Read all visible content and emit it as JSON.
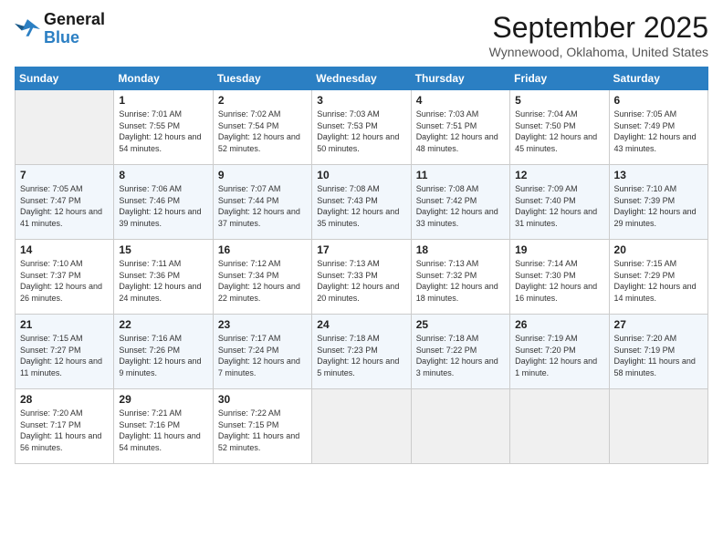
{
  "header": {
    "logo_general": "General",
    "logo_blue": "Blue",
    "month_title": "September 2025",
    "location": "Wynnewood, Oklahoma, United States"
  },
  "days_of_week": [
    "Sunday",
    "Monday",
    "Tuesday",
    "Wednesday",
    "Thursday",
    "Friday",
    "Saturday"
  ],
  "weeks": [
    [
      {
        "day": "",
        "sunrise": "",
        "sunset": "",
        "daylight": ""
      },
      {
        "day": "1",
        "sunrise": "Sunrise: 7:01 AM",
        "sunset": "Sunset: 7:55 PM",
        "daylight": "Daylight: 12 hours and 54 minutes."
      },
      {
        "day": "2",
        "sunrise": "Sunrise: 7:02 AM",
        "sunset": "Sunset: 7:54 PM",
        "daylight": "Daylight: 12 hours and 52 minutes."
      },
      {
        "day": "3",
        "sunrise": "Sunrise: 7:03 AM",
        "sunset": "Sunset: 7:53 PM",
        "daylight": "Daylight: 12 hours and 50 minutes."
      },
      {
        "day": "4",
        "sunrise": "Sunrise: 7:03 AM",
        "sunset": "Sunset: 7:51 PM",
        "daylight": "Daylight: 12 hours and 48 minutes."
      },
      {
        "day": "5",
        "sunrise": "Sunrise: 7:04 AM",
        "sunset": "Sunset: 7:50 PM",
        "daylight": "Daylight: 12 hours and 45 minutes."
      },
      {
        "day": "6",
        "sunrise": "Sunrise: 7:05 AM",
        "sunset": "Sunset: 7:49 PM",
        "daylight": "Daylight: 12 hours and 43 minutes."
      }
    ],
    [
      {
        "day": "7",
        "sunrise": "Sunrise: 7:05 AM",
        "sunset": "Sunset: 7:47 PM",
        "daylight": "Daylight: 12 hours and 41 minutes."
      },
      {
        "day": "8",
        "sunrise": "Sunrise: 7:06 AM",
        "sunset": "Sunset: 7:46 PM",
        "daylight": "Daylight: 12 hours and 39 minutes."
      },
      {
        "day": "9",
        "sunrise": "Sunrise: 7:07 AM",
        "sunset": "Sunset: 7:44 PM",
        "daylight": "Daylight: 12 hours and 37 minutes."
      },
      {
        "day": "10",
        "sunrise": "Sunrise: 7:08 AM",
        "sunset": "Sunset: 7:43 PM",
        "daylight": "Daylight: 12 hours and 35 minutes."
      },
      {
        "day": "11",
        "sunrise": "Sunrise: 7:08 AM",
        "sunset": "Sunset: 7:42 PM",
        "daylight": "Daylight: 12 hours and 33 minutes."
      },
      {
        "day": "12",
        "sunrise": "Sunrise: 7:09 AM",
        "sunset": "Sunset: 7:40 PM",
        "daylight": "Daylight: 12 hours and 31 minutes."
      },
      {
        "day": "13",
        "sunrise": "Sunrise: 7:10 AM",
        "sunset": "Sunset: 7:39 PM",
        "daylight": "Daylight: 12 hours and 29 minutes."
      }
    ],
    [
      {
        "day": "14",
        "sunrise": "Sunrise: 7:10 AM",
        "sunset": "Sunset: 7:37 PM",
        "daylight": "Daylight: 12 hours and 26 minutes."
      },
      {
        "day": "15",
        "sunrise": "Sunrise: 7:11 AM",
        "sunset": "Sunset: 7:36 PM",
        "daylight": "Daylight: 12 hours and 24 minutes."
      },
      {
        "day": "16",
        "sunrise": "Sunrise: 7:12 AM",
        "sunset": "Sunset: 7:34 PM",
        "daylight": "Daylight: 12 hours and 22 minutes."
      },
      {
        "day": "17",
        "sunrise": "Sunrise: 7:13 AM",
        "sunset": "Sunset: 7:33 PM",
        "daylight": "Daylight: 12 hours and 20 minutes."
      },
      {
        "day": "18",
        "sunrise": "Sunrise: 7:13 AM",
        "sunset": "Sunset: 7:32 PM",
        "daylight": "Daylight: 12 hours and 18 minutes."
      },
      {
        "day": "19",
        "sunrise": "Sunrise: 7:14 AM",
        "sunset": "Sunset: 7:30 PM",
        "daylight": "Daylight: 12 hours and 16 minutes."
      },
      {
        "day": "20",
        "sunrise": "Sunrise: 7:15 AM",
        "sunset": "Sunset: 7:29 PM",
        "daylight": "Daylight: 12 hours and 14 minutes."
      }
    ],
    [
      {
        "day": "21",
        "sunrise": "Sunrise: 7:15 AM",
        "sunset": "Sunset: 7:27 PM",
        "daylight": "Daylight: 12 hours and 11 minutes."
      },
      {
        "day": "22",
        "sunrise": "Sunrise: 7:16 AM",
        "sunset": "Sunset: 7:26 PM",
        "daylight": "Daylight: 12 hours and 9 minutes."
      },
      {
        "day": "23",
        "sunrise": "Sunrise: 7:17 AM",
        "sunset": "Sunset: 7:24 PM",
        "daylight": "Daylight: 12 hours and 7 minutes."
      },
      {
        "day": "24",
        "sunrise": "Sunrise: 7:18 AM",
        "sunset": "Sunset: 7:23 PM",
        "daylight": "Daylight: 12 hours and 5 minutes."
      },
      {
        "day": "25",
        "sunrise": "Sunrise: 7:18 AM",
        "sunset": "Sunset: 7:22 PM",
        "daylight": "Daylight: 12 hours and 3 minutes."
      },
      {
        "day": "26",
        "sunrise": "Sunrise: 7:19 AM",
        "sunset": "Sunset: 7:20 PM",
        "daylight": "Daylight: 12 hours and 1 minute."
      },
      {
        "day": "27",
        "sunrise": "Sunrise: 7:20 AM",
        "sunset": "Sunset: 7:19 PM",
        "daylight": "Daylight: 11 hours and 58 minutes."
      }
    ],
    [
      {
        "day": "28",
        "sunrise": "Sunrise: 7:20 AM",
        "sunset": "Sunset: 7:17 PM",
        "daylight": "Daylight: 11 hours and 56 minutes."
      },
      {
        "day": "29",
        "sunrise": "Sunrise: 7:21 AM",
        "sunset": "Sunset: 7:16 PM",
        "daylight": "Daylight: 11 hours and 54 minutes."
      },
      {
        "day": "30",
        "sunrise": "Sunrise: 7:22 AM",
        "sunset": "Sunset: 7:15 PM",
        "daylight": "Daylight: 11 hours and 52 minutes."
      },
      {
        "day": "",
        "sunrise": "",
        "sunset": "",
        "daylight": ""
      },
      {
        "day": "",
        "sunrise": "",
        "sunset": "",
        "daylight": ""
      },
      {
        "day": "",
        "sunrise": "",
        "sunset": "",
        "daylight": ""
      },
      {
        "day": "",
        "sunrise": "",
        "sunset": "",
        "daylight": ""
      }
    ]
  ]
}
